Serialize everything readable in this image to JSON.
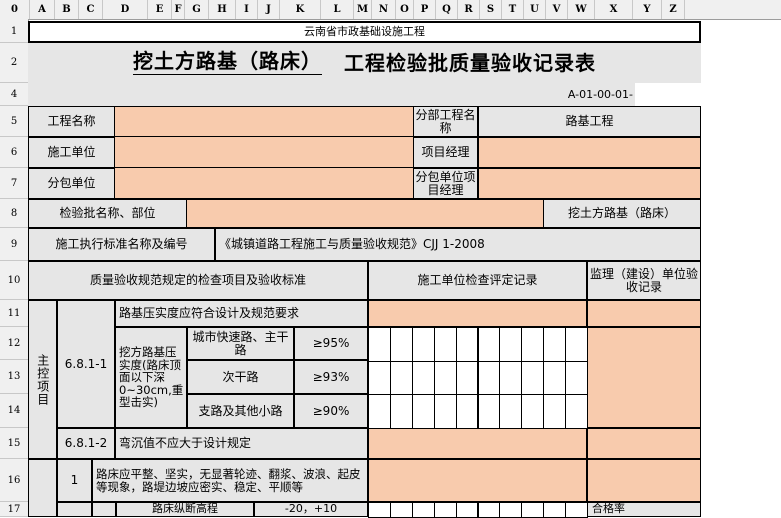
{
  "columns": [
    "0",
    "A",
    "B",
    "C",
    "D",
    "E",
    "F",
    "G",
    "H",
    "I",
    "J",
    "K",
    "L",
    "M",
    "N",
    "O",
    "P",
    "Q",
    "R",
    "S",
    "T",
    "U",
    "V",
    "W",
    "X",
    "Y",
    "Z"
  ],
  "rows": [
    "1",
    "2",
    "4",
    "5",
    "6",
    "7",
    "8",
    "9",
    "10",
    "11",
    "12",
    "13",
    "14",
    "15",
    "16",
    "17"
  ],
  "sheet": {
    "org_title": "云南省市政基础设施工程",
    "main_title_a": "挖土方路基（路床）",
    "main_title_b": "工程检验批质量验收记录表",
    "code": "A-01-00-01-",
    "project_name_label": "工程名称",
    "sub_project_label": "分部工程名称",
    "sub_project_value": "路基工程",
    "construction_unit_label": "施工单位",
    "project_manager_label": "项目经理",
    "subcontract_unit_label": "分包单位",
    "subcontract_manager_label": "分包单位项目经理",
    "batch_name_label": "检验批名称、部位",
    "batch_name_value": "挖土方路基（路床）",
    "standard_label": "施工执行标准名称及编号",
    "standard_value": "《城镇道路工程施工与质量验收规范》CJJ 1-2008",
    "quality_items_header": "质量验收规范规定的检查项目及验收标准",
    "construction_record_header": "施工单位检查评定记录",
    "supervision_header": "监理（建设）单位验收记录",
    "main_control_label": "主控项目",
    "clause_1": "6.8.1-1",
    "clause_1_req": "路基压实度应符合设计及规范要求",
    "clause_1_sub": "挖方路基压实度(路床顶面以下深0~30cm,重型击实)",
    "road_type_1": "城市快速路、主干路",
    "road_type_1_value": "≥95%",
    "road_type_2": "次干路",
    "road_type_2_value": "≥93%",
    "road_type_3": "支路及其他小路",
    "road_type_3_value": "≥90%",
    "clause_2": "6.8.1-2",
    "clause_2_req": "弯沉值不应大于设计规定",
    "general_item_no": "1",
    "general_item_text": "路床应平整、坚实，无显著轮迹、翻浆、波浪、起皮等现象，路堤边坡应密实、稳定、平顺等",
    "row17_text": "路床纵断高程",
    "row17_value": "-20，+10",
    "row17_pass": "合格率"
  }
}
